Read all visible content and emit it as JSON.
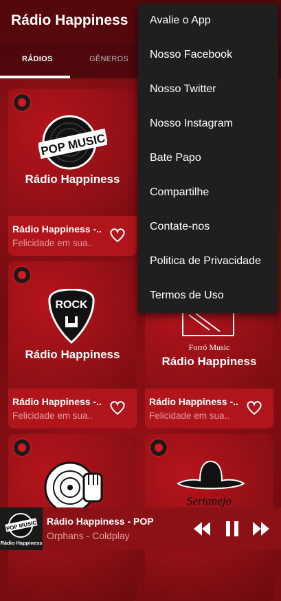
{
  "app": {
    "title": "Rádio Happiness"
  },
  "tabs": [
    {
      "label": "RÁDIOS",
      "active": true
    },
    {
      "label": "GÊNEROS",
      "active": false
    }
  ],
  "menu": {
    "items": [
      "Avalie o App",
      "Nosso Facebook",
      "Nosso Twitter",
      "Nosso Instagram",
      "Bate Papo",
      "Compartilhe",
      "Contate-nos",
      "Politica de Privacidade",
      "Termos de Uso"
    ]
  },
  "cards": [
    {
      "logo": "POP MUSIC",
      "brand": "Rádio Happiness",
      "name": "Rádio Happiness -..",
      "desc": "Felicidade em sua..",
      "icon": "vinyl-record-icon"
    },
    {
      "logo": "ROCK",
      "brand": "Rádio Happiness",
      "name": "Rádio Happiness -..",
      "desc": "Felicidade em sua..",
      "icon": "guitar-pick-icon"
    },
    {
      "sub": "Forró Music",
      "brand": "Rádio Happiness",
      "name": "Rádio Happiness -..",
      "desc": "Felicidade em sua..",
      "icon": "music-sheet-icon"
    },
    {
      "icon": "dj-hand-icon"
    },
    {
      "script": "Sertanejo",
      "icon": "cowboy-hat-icon"
    }
  ],
  "player": {
    "title": "Rádio Happiness - POP",
    "subtitle": "Orphans - Coldplay",
    "thumb_label": "POP MUSIC",
    "thumb_brand": "Rádio Happiness"
  },
  "colors": {
    "accent": "#b0151c",
    "menu_bg": "#1f1f1f",
    "player_bg": "#8c1116"
  }
}
